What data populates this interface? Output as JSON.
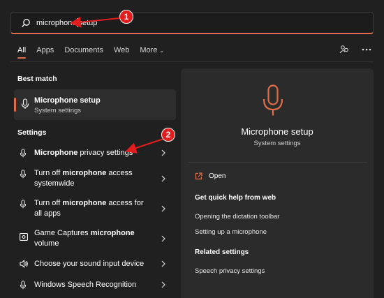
{
  "search": {
    "query_bold": "microphone",
    "query_rest": "setup"
  },
  "tabs": [
    {
      "label": "All"
    },
    {
      "label": "Apps"
    },
    {
      "label": "Documents"
    },
    {
      "label": "Web"
    },
    {
      "label": "More"
    }
  ],
  "best_match": {
    "heading": "Best match",
    "title": "Microphone setup",
    "subtitle": "System settings"
  },
  "settings": {
    "heading": "Settings",
    "items": [
      {
        "icon": "microphone-icon",
        "bold": "Microphone",
        "rest": " privacy settings"
      },
      {
        "icon": "microphone-icon",
        "pre": "Turn off ",
        "bold": "microphone",
        "rest": " access systemwide"
      },
      {
        "icon": "microphone-icon",
        "pre": "Turn off ",
        "bold": "microphone",
        "rest": " access for all apps"
      },
      {
        "icon": "game-capture-icon",
        "pre": "Game Captures ",
        "bold": "microphone",
        "rest": " volume"
      },
      {
        "icon": "speaker-icon",
        "pre": "Choose your sound input device"
      },
      {
        "icon": "microphone-icon",
        "pre": "Windows Speech Recognition"
      }
    ]
  },
  "detail": {
    "title": "Microphone setup",
    "subtitle": "System settings",
    "open_label": "Open",
    "help_heading": "Get quick help from web",
    "help_links": [
      "Opening the dictation toolbar",
      "Setting up a microphone"
    ],
    "related_heading": "Related settings",
    "related_links": [
      "Speech privacy settings"
    ]
  },
  "annotations": [
    "1",
    "2"
  ],
  "colors": {
    "accent": "#e06d49",
    "background": "#202020",
    "panel": "#2b2b2b",
    "annotation": "#e21d1d"
  }
}
